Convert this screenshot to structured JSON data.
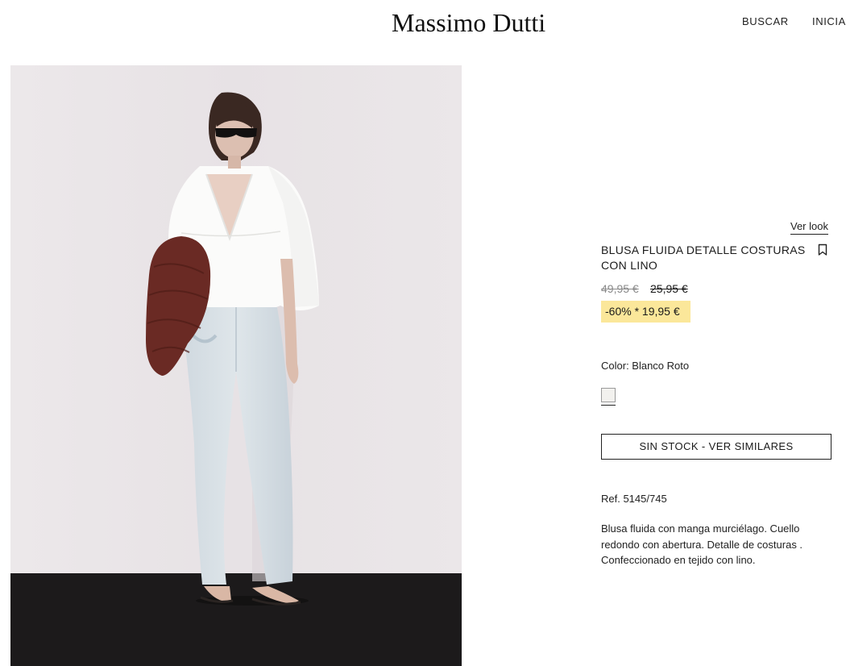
{
  "header": {
    "logo": "Massimo Dutti",
    "nav": {
      "search": "BUSCAR",
      "login": "INICIAR"
    }
  },
  "product": {
    "image_alt": "Modelo con blusa blanca fluida y vaqueros",
    "ver_look": "Ver look",
    "title": "BLUSA FLUIDA DETALLE COSTURAS CON LINO",
    "prices": {
      "original": "49,95 €",
      "previous": "25,95 €",
      "sale": "-60% * 19,95 €"
    },
    "color_label": "Color: Blanco Roto",
    "swatch_color": "#f2f1ee",
    "stock_button": "SIN STOCK - VER SIMILARES",
    "reference": "Ref. 5145/745",
    "description": "Blusa fluida con manga murciélago. Cuello redondo con abertura. Detalle de costuras . Confeccionado en tejido con lino."
  },
  "colors": {
    "sale_highlight": "#fbe79a",
    "text": "#1a1a1a",
    "old_price": "#8a8a8a"
  },
  "icons": {
    "bookmark": "bookmark-icon"
  }
}
